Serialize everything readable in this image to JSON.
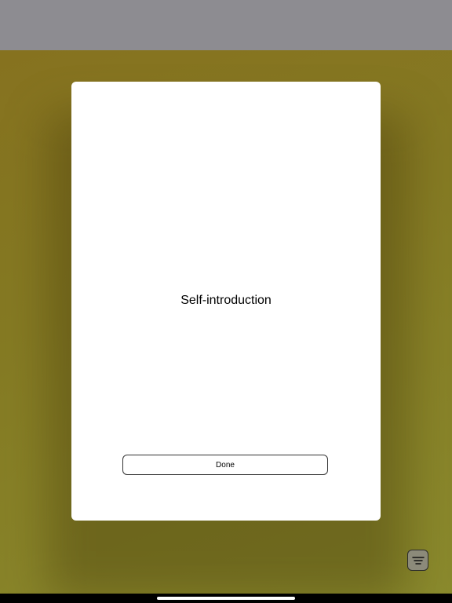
{
  "modal": {
    "title": "Self-introduction",
    "done_label": "Done"
  },
  "menu_button": {
    "icon": "menu-lines-icon"
  },
  "colors": {
    "top_bar": "#8d8c91",
    "backdrop": "#86721f",
    "modal_bg": "#ffffff"
  }
}
